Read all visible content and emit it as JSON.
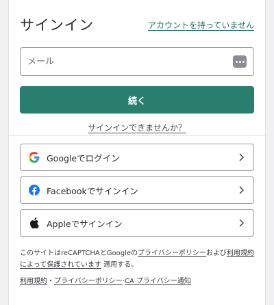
{
  "header": {
    "title": "サインイン",
    "create_account_link": "アカウントを持っていません"
  },
  "email": {
    "placeholder": "メール",
    "value": ""
  },
  "continue_button": "続く",
  "trouble_link": "サインインできませんか？",
  "social": [
    {
      "label": "Googleでログイン",
      "icon": "google-icon"
    },
    {
      "label": "Facebookでサインイン",
      "icon": "facebook-icon"
    },
    {
      "label": "Appleでサインイン",
      "icon": "apple-icon"
    }
  ],
  "legal": {
    "part1": "このサイトはreCAPTCHAとGoogleの",
    "privacy_link": "プライバシーポリシー",
    "part2": "および",
    "terms_link": "利用規約によって保護されています",
    "part3": " 適用する。"
  },
  "footer": {
    "terms": "利用規約",
    "sep1": "・",
    "privacy": "プライバシーポリシー",
    "sep2": "·",
    "ca_privacy": "CA プライバシー通知"
  },
  "colors": {
    "accent": "#2a7e6d",
    "link": "#1f6f62"
  }
}
